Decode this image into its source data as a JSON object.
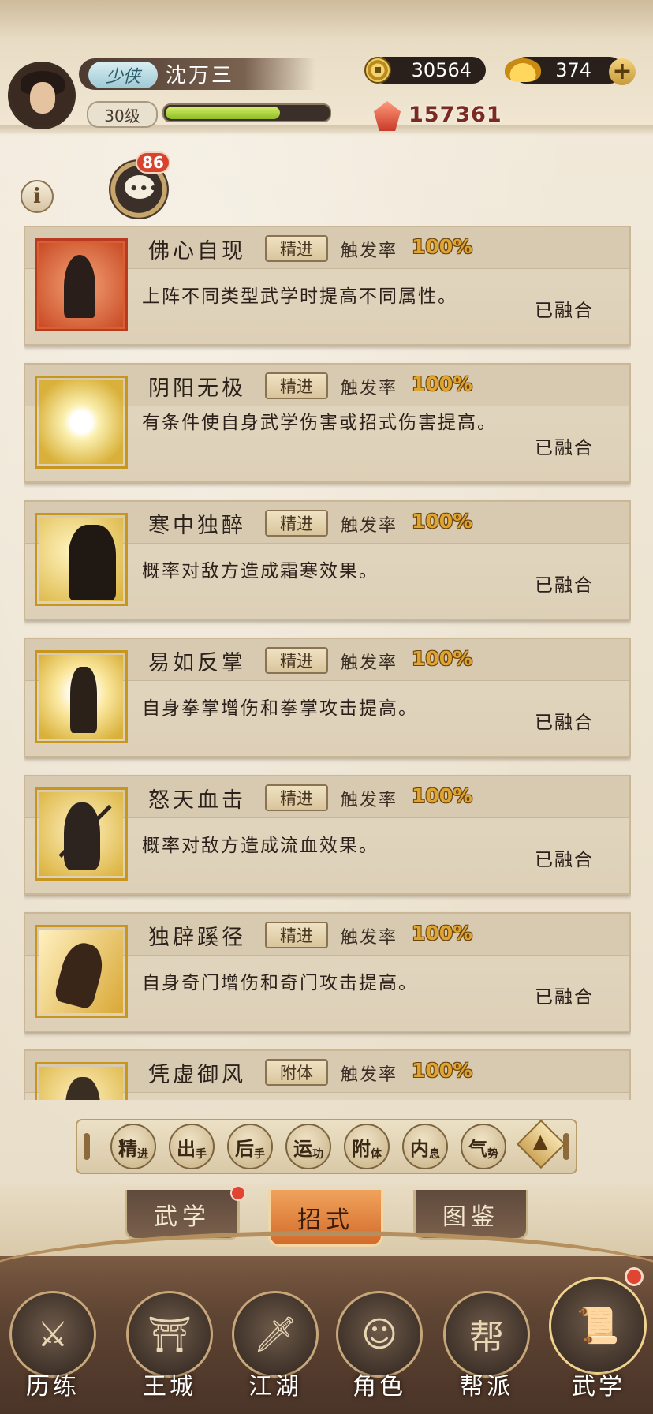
{
  "player": {
    "title": "少侠",
    "name": "沈万三",
    "level": "30级",
    "exp_fraction": 0.72,
    "power": "157361"
  },
  "currency": {
    "coins": "30564",
    "ingots": "374"
  },
  "chat": {
    "badge": "86"
  },
  "skills": [
    {
      "name": "佛心自现",
      "tag": "精进",
      "rate_label": "触发率",
      "rate": "100%",
      "desc": "上阵不同类型武学时提高不同属性。",
      "status": "已融合",
      "icon": "praying-hands-icon"
    },
    {
      "name": "阴阳无极",
      "tag": "精进",
      "rate_label": "触发率",
      "rate": "100%",
      "desc": "有条件使自身武学伤害或招式伤害提高。",
      "status": "已融合",
      "icon": "swirl-light-icon"
    },
    {
      "name": "寒中独醉",
      "tag": "精进",
      "rate_label": "触发率",
      "rate": "100%",
      "desc": "概率对敌方造成霜寒效果。",
      "status": "已融合",
      "icon": "drinking-figure-icon"
    },
    {
      "name": "易如反掌",
      "tag": "精进",
      "rate_label": "触发率",
      "rate": "100%",
      "desc": "自身拳掌增伤和拳掌攻击提高。",
      "status": "已融合",
      "icon": "palm-strike-icon"
    },
    {
      "name": "怒天血击",
      "tag": "精进",
      "rate_label": "触发率",
      "rate": "100%",
      "desc": "概率对敌方造成流血效果。",
      "status": "已融合",
      "icon": "swordsman-icon"
    },
    {
      "name": "独辟蹊径",
      "tag": "精进",
      "rate_label": "触发率",
      "rate": "100%",
      "desc": "自身奇门增伤和奇门攻击提高。",
      "status": "已融合",
      "icon": "running-figure-icon"
    },
    {
      "name": "凭虚御风",
      "tag": "附体",
      "rate_label": "触发率",
      "rate": "100%",
      "desc": "",
      "status": "",
      "icon": "wind-figure-icon"
    }
  ],
  "filters": [
    {
      "main": "精",
      "sub": "进"
    },
    {
      "main": "出",
      "sub": "手"
    },
    {
      "main": "后",
      "sub": "手"
    },
    {
      "main": "运",
      "sub": "功"
    },
    {
      "main": "附",
      "sub": "体"
    },
    {
      "main": "内",
      "sub": "息"
    },
    {
      "main": "气",
      "sub": "势"
    }
  ],
  "tabs": [
    "武学",
    "招式",
    "图鉴"
  ],
  "active_tab": "招式",
  "nav": [
    "历练",
    "王城",
    "江湖",
    "角色",
    "帮派",
    "武学"
  ]
}
